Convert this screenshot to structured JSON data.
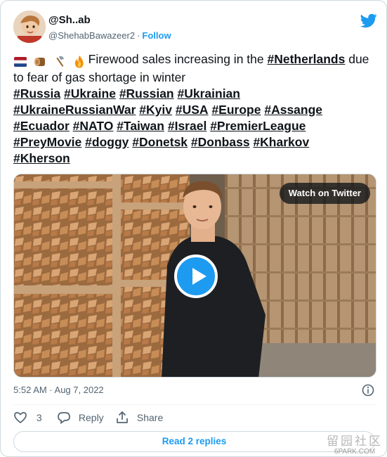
{
  "author": {
    "display_name": "@Sh..ab",
    "handle": "@ShehabBawazeer2",
    "separator": "·",
    "follow_label": "Follow"
  },
  "tweet": {
    "lead_text": "Firewood sales increasing in the ",
    "lead_tag": "#Netherlands",
    "lead_rest": " due to fear of gas shortage in winter",
    "emojis": [
      "netherlands-flag-icon",
      "wood-log-icon",
      "axe-icon",
      "fire-icon"
    ],
    "hashtags": [
      "#Russia",
      "#Ukraine",
      "#Russian",
      "#Ukrainian",
      "#UkraineRussianWar",
      "#Kyiv",
      "#USA",
      "#Europe",
      "#Assange",
      "#Ecuador",
      "#NATO",
      "#Taiwan",
      "#Israel",
      "#PremierLeague",
      "#PreyMovie",
      "#doggy",
      "#Donetsk",
      "#Donbass",
      "#Kharkov",
      "#Kherson"
    ]
  },
  "media": {
    "watch_label": "Watch on Twitter"
  },
  "meta": {
    "timestamp": "5:52 AM · Aug 7, 2022"
  },
  "actions": {
    "like_count": "3",
    "reply_label": "Reply",
    "share_label": "Share"
  },
  "footer": {
    "read_replies_label": "Read 2 replies"
  },
  "watermark": {
    "cn_text": "留园社区",
    "site": "6PARK.COM"
  },
  "colors": {
    "accent": "#1d9bf0",
    "text": "#0f1419",
    "muted": "#536471",
    "border": "#cfd9de"
  }
}
